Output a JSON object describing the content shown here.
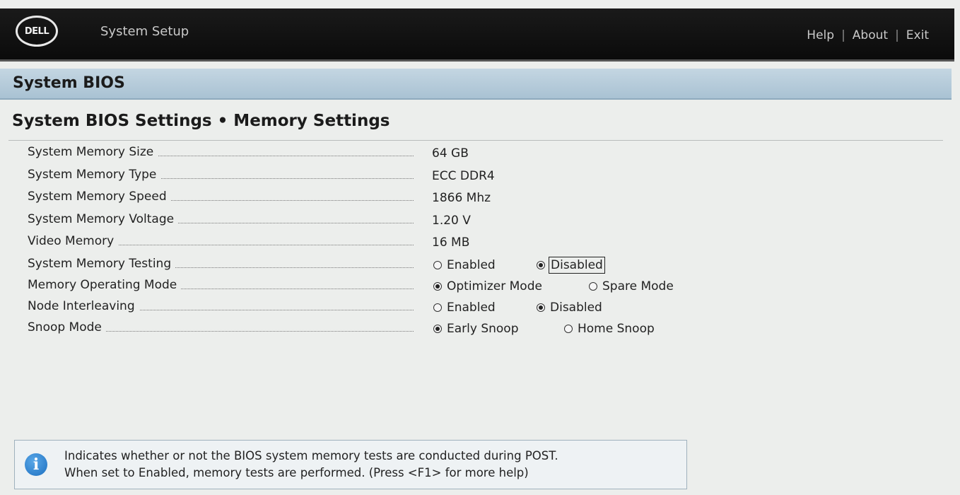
{
  "header": {
    "logo_text": "DELL",
    "app_title": "System Setup",
    "nav": [
      "Help",
      "About",
      "Exit"
    ]
  },
  "section": {
    "title": "System BIOS"
  },
  "page": {
    "title": "System BIOS Settings • Memory Settings"
  },
  "settings": [
    {
      "label": "System Memory Size",
      "value": "64 GB"
    },
    {
      "label": "System Memory Type",
      "value": "ECC DDR4"
    },
    {
      "label": "System Memory Speed",
      "value": "1866 Mhz"
    },
    {
      "label": "System Memory Voltage",
      "value": "1.20 V"
    },
    {
      "label": "Video Memory",
      "value": "16 MB"
    },
    {
      "label": "System Memory Testing",
      "options": [
        "Enabled",
        "Disabled"
      ],
      "selected": "Disabled"
    },
    {
      "label": "Memory Operating Mode",
      "options": [
        "Optimizer Mode",
        "Spare Mode"
      ],
      "selected": "Optimizer Mode"
    },
    {
      "label": "Node Interleaving",
      "options": [
        "Enabled",
        "Disabled"
      ],
      "selected": "Disabled"
    },
    {
      "label": "Snoop Mode",
      "options": [
        "Early Snoop",
        "Home Snoop"
      ],
      "selected": "Early Snoop"
    }
  ],
  "help": {
    "icon": "info-icon",
    "line1": "Indicates whether or not the BIOS system memory tests are conducted during POST.",
    "line2": "When set to Enabled, memory tests are performed. (Press <F1> for more help)"
  }
}
